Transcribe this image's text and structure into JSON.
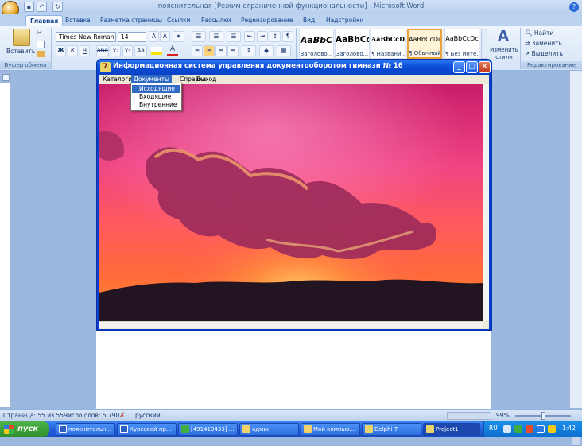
{
  "word": {
    "title": "пояснительная [Режим ограниченной функциональности] - Microsoft Word",
    "tabs": [
      "Главная",
      "Вставка",
      "Разметка страницы",
      "Ссылки",
      "Рассылки",
      "Рецензирование",
      "Вид",
      "Надстройки"
    ],
    "active_tab": "Главная",
    "clipboard": {
      "paste_label": "Вставить",
      "group_label": "Буфер обмена"
    },
    "font": {
      "name": "Times New Roman",
      "size": "14"
    },
    "format_buttons": [
      "Ж",
      "К",
      "Ч",
      "abe",
      "x₂",
      "x²",
      "Aa"
    ],
    "styles": [
      {
        "sample": "AaBbC",
        "name": "Заголово..."
      },
      {
        "sample": "AaBbCc",
        "name": "Заголово..."
      },
      {
        "sample": "AaBbCcDd",
        "name": "¶ Названи..."
      },
      {
        "sample": "AaBbCcDc",
        "name": "¶ Обычный"
      },
      {
        "sample": "AaBbCcDc",
        "name": "¶ Без инте..."
      }
    ],
    "change_styles_label": "Изменить стили",
    "editing": {
      "find": "Найти",
      "replace": "Заменить",
      "select": "Выделить",
      "group_label": "Редактирование"
    },
    "status": {
      "page": "Страница: 55 из 55",
      "words": "Число слов: 5 790",
      "lang": "русский",
      "zoom": "99%"
    }
  },
  "delphi": {
    "title": "Информационная система управления документооборотом гимнази № 16",
    "icon_glyph": "7",
    "menu": [
      "Каталоги",
      "Документы",
      "Справка",
      "Выход"
    ],
    "open_menu": "Документы",
    "dropdown": [
      "Исходящие",
      "Входящие",
      "Внутренние"
    ],
    "dropdown_selected": "Исходящие"
  },
  "taskbar": {
    "start_label": "пуск",
    "tasks": [
      "пояснительн...",
      "Курсовой пр...",
      "[491419433] ...",
      "админ",
      "Мой компью...",
      "Delphi 7",
      "Project1"
    ],
    "active_task": "Project1",
    "lang": "RU",
    "clock": "1:42"
  },
  "colors": {
    "delphi_titlebar": "#0b4ed8",
    "menu_highlight": "#316ac5",
    "taskbar": "#245edb"
  }
}
